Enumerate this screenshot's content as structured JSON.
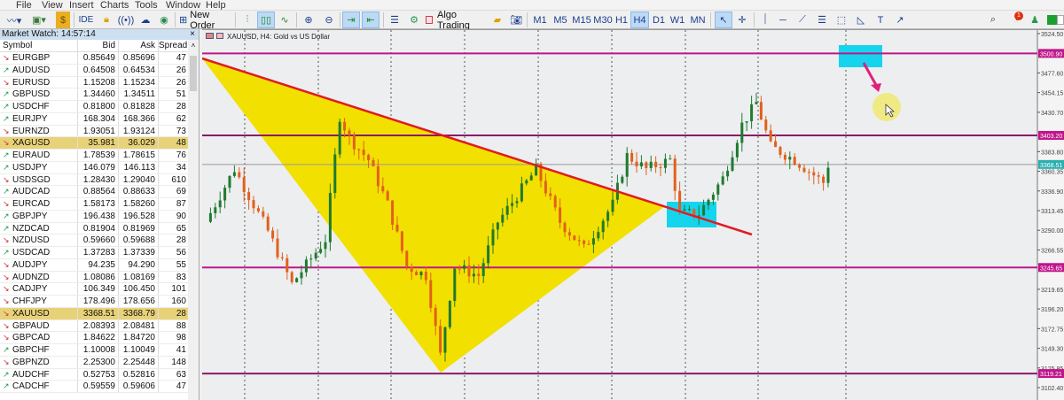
{
  "menu": [
    "File",
    "View",
    "Insert",
    "Charts",
    "Tools",
    "Window",
    "Help"
  ],
  "toolbar": {
    "ide": "IDE",
    "new_order": "New Order",
    "algo_trading": "Algo Trading",
    "timeframes": [
      "M1",
      "M5",
      "M15",
      "M30",
      "H1",
      "H4",
      "D1",
      "W1",
      "MN"
    ],
    "active_timeframe": "H4",
    "notification_count": "1"
  },
  "market_watch": {
    "title": "Market Watch: 14:57:14",
    "close": "×",
    "headers": [
      "Symbol",
      "Bid",
      "Ask",
      "Spread"
    ],
    "rows": [
      [
        "EURGBP",
        "0.85649",
        "0.85696",
        "47",
        "down"
      ],
      [
        "AUDUSD",
        "0.64508",
        "0.64534",
        "26",
        "up"
      ],
      [
        "EURUSD",
        "1.15208",
        "1.15234",
        "26",
        "down"
      ],
      [
        "GBPUSD",
        "1.34460",
        "1.34511",
        "51",
        "up"
      ],
      [
        "USDCHF",
        "0.81800",
        "0.81828",
        "28",
        "up"
      ],
      [
        "EURJPY",
        "168.304",
        "168.366",
        "62",
        "up"
      ],
      [
        "EURNZD",
        "1.93051",
        "1.93124",
        "73",
        "down"
      ],
      [
        "XAGUSD",
        "35.981",
        "36.029",
        "48",
        "down"
      ],
      [
        "EURAUD",
        "1.78539",
        "1.78615",
        "76",
        "up"
      ],
      [
        "USDJPY",
        "146.079",
        "146.113",
        "34",
        "up"
      ],
      [
        "USDSGD",
        "1.28430",
        "1.29040",
        "610",
        "down"
      ],
      [
        "AUDCAD",
        "0.88564",
        "0.88633",
        "69",
        "up"
      ],
      [
        "EURCAD",
        "1.58173",
        "1.58260",
        "87",
        "down"
      ],
      [
        "GBPJPY",
        "196.438",
        "196.528",
        "90",
        "up"
      ],
      [
        "NZDCAD",
        "0.81904",
        "0.81969",
        "65",
        "up"
      ],
      [
        "NZDUSD",
        "0.59660",
        "0.59688",
        "28",
        "down"
      ],
      [
        "USDCAD",
        "1.37283",
        "1.37339",
        "56",
        "up"
      ],
      [
        "AUDJPY",
        "94.235",
        "94.290",
        "55",
        "down"
      ],
      [
        "AUDNZD",
        "1.08086",
        "1.08169",
        "83",
        "down"
      ],
      [
        "CADJPY",
        "106.349",
        "106.450",
        "101",
        "down"
      ],
      [
        "CHFJPY",
        "178.496",
        "178.656",
        "160",
        "down"
      ],
      [
        "XAUUSD",
        "3368.51",
        "3368.79",
        "28",
        "down"
      ],
      [
        "GBPAUD",
        "2.08393",
        "2.08481",
        "88",
        "down"
      ],
      [
        "GBPCAD",
        "1.84622",
        "1.84720",
        "98",
        "down"
      ],
      [
        "GBPCHF",
        "1.10008",
        "1.10049",
        "41",
        "up"
      ],
      [
        "GBPNZD",
        "2.25300",
        "2.25448",
        "148",
        "down"
      ],
      [
        "AUDCHF",
        "0.52753",
        "0.52816",
        "63",
        "up"
      ],
      [
        "CADCHF",
        "0.59559",
        "0.59606",
        "47",
        "up"
      ]
    ],
    "highlighted": [
      "XAGUSD",
      "XAUUSD"
    ]
  },
  "chart": {
    "title": "XAUUSD, H4:  Gold vs US Dollar"
  },
  "chart_data": {
    "type": "candlestick",
    "symbol": "XAUUSD",
    "timeframe": "H4",
    "ylim": [
      3102.4,
      3524.5
    ],
    "price_ticks": [
      "3524.50",
      "3477.60",
      "3454.15",
      "3430.70",
      "3383.80",
      "3360.35",
      "3336.90",
      "3313.45",
      "3290.00",
      "3266.55",
      "3219.65",
      "3196.20",
      "3172.75",
      "3149.30",
      "3125.85",
      "3102.40"
    ],
    "levels": [
      {
        "price": 3500.9,
        "label": "3500.90"
      },
      {
        "price": 3403.2,
        "label": "3403.20"
      },
      {
        "price": 3245.65,
        "label": "3245.65"
      },
      {
        "price": 3119.21,
        "label": "3119.21"
      }
    ],
    "current_price": {
      "price": 3368.51,
      "label": "3368.51"
    },
    "path_keypoints": [
      [
        0,
        3300
      ],
      [
        6,
        3363
      ],
      [
        13,
        3289
      ],
      [
        18,
        3226
      ],
      [
        25,
        3279
      ],
      [
        28,
        3426
      ],
      [
        30,
        3400
      ],
      [
        34,
        3374
      ],
      [
        38,
        3321
      ],
      [
        42,
        3247
      ],
      [
        46,
        3236
      ],
      [
        49,
        3141
      ],
      [
        52,
        3247
      ],
      [
        57,
        3236
      ],
      [
        61,
        3300
      ],
      [
        65,
        3331
      ],
      [
        69,
        3363
      ],
      [
        74,
        3300
      ],
      [
        79,
        3268
      ],
      [
        85,
        3321
      ],
      [
        88,
        3379
      ],
      [
        92,
        3363
      ],
      [
        97,
        3374
      ],
      [
        99,
        3310
      ],
      [
        103,
        3310
      ],
      [
        108,
        3352
      ],
      [
        112,
        3416
      ],
      [
        115,
        3442
      ],
      [
        118,
        3390
      ],
      [
        123,
        3374
      ],
      [
        129,
        3347
      ],
      [
        130,
        3368
      ]
    ],
    "colors": {
      "up": "#1f7a2e",
      "down": "#e2601c",
      "level": "#c0168a",
      "trendline": "#e01b24",
      "triangle": "#f2e000",
      "zone": "#14d4ee"
    }
  }
}
